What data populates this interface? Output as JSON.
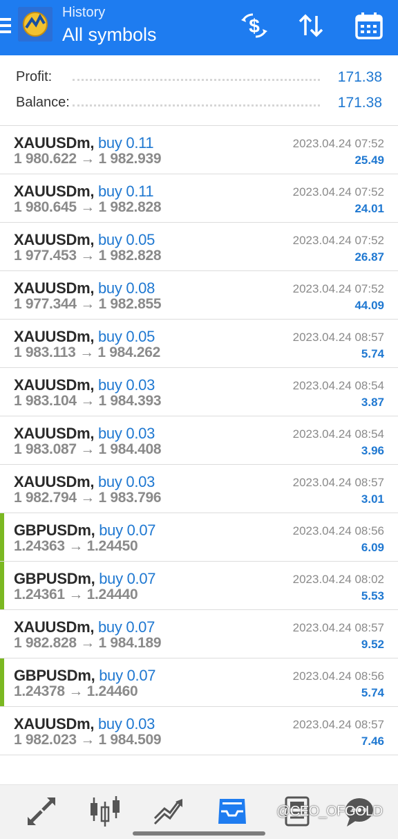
{
  "header": {
    "subtitle": "History",
    "title": "All symbols"
  },
  "summary": {
    "profit_label": "Profit:",
    "profit_value": "171.38",
    "balance_label": "Balance:",
    "balance_value": "171.38"
  },
  "deals": [
    {
      "symbol": "XAUUSDm,",
      "side": "buy 0.11",
      "prices": "1 980.622 → 1 982.939",
      "time": "2023.04.24 07:52",
      "profit": "25.49",
      "marked": false
    },
    {
      "symbol": "XAUUSDm,",
      "side": "buy 0.11",
      "prices": "1 980.645 → 1 982.828",
      "time": "2023.04.24 07:52",
      "profit": "24.01",
      "marked": false
    },
    {
      "symbol": "XAUUSDm,",
      "side": "buy 0.05",
      "prices": "1 977.453 → 1 982.828",
      "time": "2023.04.24 07:52",
      "profit": "26.87",
      "marked": false
    },
    {
      "symbol": "XAUUSDm,",
      "side": "buy 0.08",
      "prices": "1 977.344 → 1 982.855",
      "time": "2023.04.24 07:52",
      "profit": "44.09",
      "marked": false
    },
    {
      "symbol": "XAUUSDm,",
      "side": "buy 0.05",
      "prices": "1 983.113 → 1 984.262",
      "time": "2023.04.24 08:57",
      "profit": "5.74",
      "marked": false
    },
    {
      "symbol": "XAUUSDm,",
      "side": "buy 0.03",
      "prices": "1 983.104 → 1 984.393",
      "time": "2023.04.24 08:54",
      "profit": "3.87",
      "marked": false
    },
    {
      "symbol": "XAUUSDm,",
      "side": "buy 0.03",
      "prices": "1 983.087 → 1 984.408",
      "time": "2023.04.24 08:54",
      "profit": "3.96",
      "marked": false
    },
    {
      "symbol": "XAUUSDm,",
      "side": "buy 0.03",
      "prices": "1 982.794 → 1 983.796",
      "time": "2023.04.24 08:57",
      "profit": "3.01",
      "marked": false
    },
    {
      "symbol": "GBPUSDm,",
      "side": "buy 0.07",
      "prices": "1.24363 → 1.24450",
      "time": "2023.04.24 08:56",
      "profit": "6.09",
      "marked": true
    },
    {
      "symbol": "GBPUSDm,",
      "side": "buy 0.07",
      "prices": "1.24361 → 1.24440",
      "time": "2023.04.24 08:02",
      "profit": "5.53",
      "marked": true
    },
    {
      "symbol": "XAUUSDm,",
      "side": "buy 0.07",
      "prices": "1 982.828 → 1 984.189",
      "time": "2023.04.24 08:57",
      "profit": "9.52",
      "marked": false
    },
    {
      "symbol": "GBPUSDm,",
      "side": "buy 0.07",
      "prices": "1.24378 → 1.24460",
      "time": "2023.04.24 08:56",
      "profit": "5.74",
      "marked": true
    },
    {
      "symbol": "XAUUSDm,",
      "side": "buy 0.03",
      "prices": "1 982.023 → 1 984.509",
      "time": "2023.04.24 08:57",
      "profit": "7.46",
      "marked": false
    }
  ],
  "nav": {
    "items": [
      "quotes-icon",
      "chart-icon",
      "trade-icon",
      "history-icon",
      "news-icon",
      "messages-icon"
    ],
    "active": "history-icon",
    "accent": "#1e7cf0"
  },
  "watermark": "@CEO_OFGOLD",
  "colors": {
    "header": "#1e7cf0",
    "accent": "#1f78d1",
    "marker": "#7bb822"
  }
}
